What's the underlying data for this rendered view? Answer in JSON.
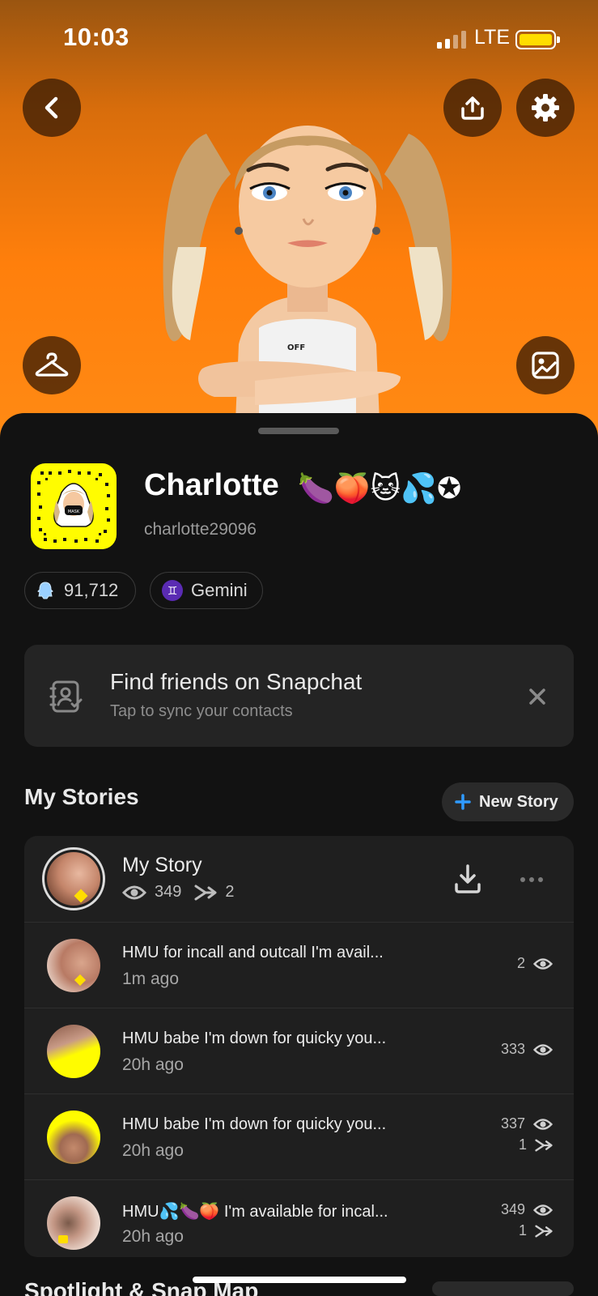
{
  "status_bar": {
    "time": "10:03",
    "network": "LTE"
  },
  "colors": {
    "accent": "#ff8a14",
    "snapcode": "#fffc00",
    "battery": "#ffdd00",
    "new_story_plus": "#2f9bff"
  },
  "icons": {
    "back": "chevron-left-icon",
    "share": "upload-icon",
    "settings": "gear-icon",
    "outfit": "hanger-icon",
    "selfie": "image-icon"
  },
  "profile": {
    "display_name": "Charlotte",
    "name_emojis": "🍆🍑🐱💦✪",
    "username": "charlotte29096",
    "snap_score": "91,712",
    "zodiac": "Gemini",
    "zodiac_symbol": "♊"
  },
  "find_friends": {
    "title": "Find friends on Snapchat",
    "subtitle": "Tap to sync your contacts"
  },
  "my_stories": {
    "section_title": "My Stories",
    "new_story_label": "New Story",
    "story": {
      "title": "My Story",
      "views": "349",
      "screenshots": "2"
    },
    "snaps": [
      {
        "caption": "HMU for incall and outcall I'm avail...",
        "time": "1m ago",
        "views": "2",
        "screenshots": ""
      },
      {
        "caption": "HMU babe I'm down for quicky you...",
        "time": "20h ago",
        "views": "333",
        "screenshots": ""
      },
      {
        "caption": "HMU babe I'm down for quicky you...",
        "time": "20h ago",
        "views": "337",
        "screenshots": "1"
      },
      {
        "caption_prefix": "HMU",
        "caption_emojis": "💦🍆🍑",
        "caption": " I'm available for incal...",
        "time": "20h ago",
        "views": "349",
        "screenshots": "1"
      }
    ]
  },
  "bottom_section": {
    "title": "Spotlight & Snap Map"
  }
}
